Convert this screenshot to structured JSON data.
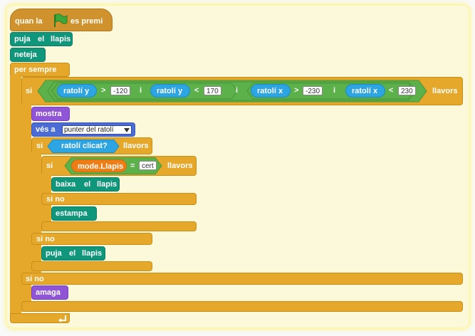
{
  "hat": {
    "before": "quan la",
    "after": "es premi",
    "flag_icon": "green-flag-icon",
    "flag_color": "#3ca83a"
  },
  "blocks": {
    "pen_up_1": {
      "w1": "puja",
      "w2": "el",
      "w3": "llapis"
    },
    "clear": "neteja",
    "forever": "per sempre",
    "if_outer": "si",
    "then": "llavors",
    "and": "i",
    "mouse_y": "ratolí y",
    "mouse_x": "ratolí x",
    "gt": ">",
    "lt": "<",
    "val_y_min": "-120",
    "val_y_max": "170",
    "val_x_min": "-230",
    "val_x_max": "230",
    "show": "mostra",
    "goto_label": "vés a",
    "goto_target": "punter del ratolí",
    "if_mouse": "si",
    "mouse_down": "ratolí clicat?",
    "if_mode": "si",
    "mode_var": "mode.Llapis",
    "eq": "=",
    "true_val": "cert",
    "pen_down": {
      "w1": "baixa",
      "w2": "el",
      "w3": "llapis"
    },
    "else_inner": "si no",
    "stamp": "estampa",
    "else_mid": "si no",
    "pen_up_2": {
      "w1": "puja",
      "w2": "el",
      "w3": "llapis"
    },
    "else_outer": "si no",
    "hide": "amaga"
  },
  "colors": {
    "control": "#e6a82a",
    "pen": "#10967a",
    "looks": "#8f55d6",
    "motion": "#4a6cd4",
    "operators": "#5cb14a",
    "sensing": "#2ca5e2",
    "variables": "#ee7d16"
  }
}
